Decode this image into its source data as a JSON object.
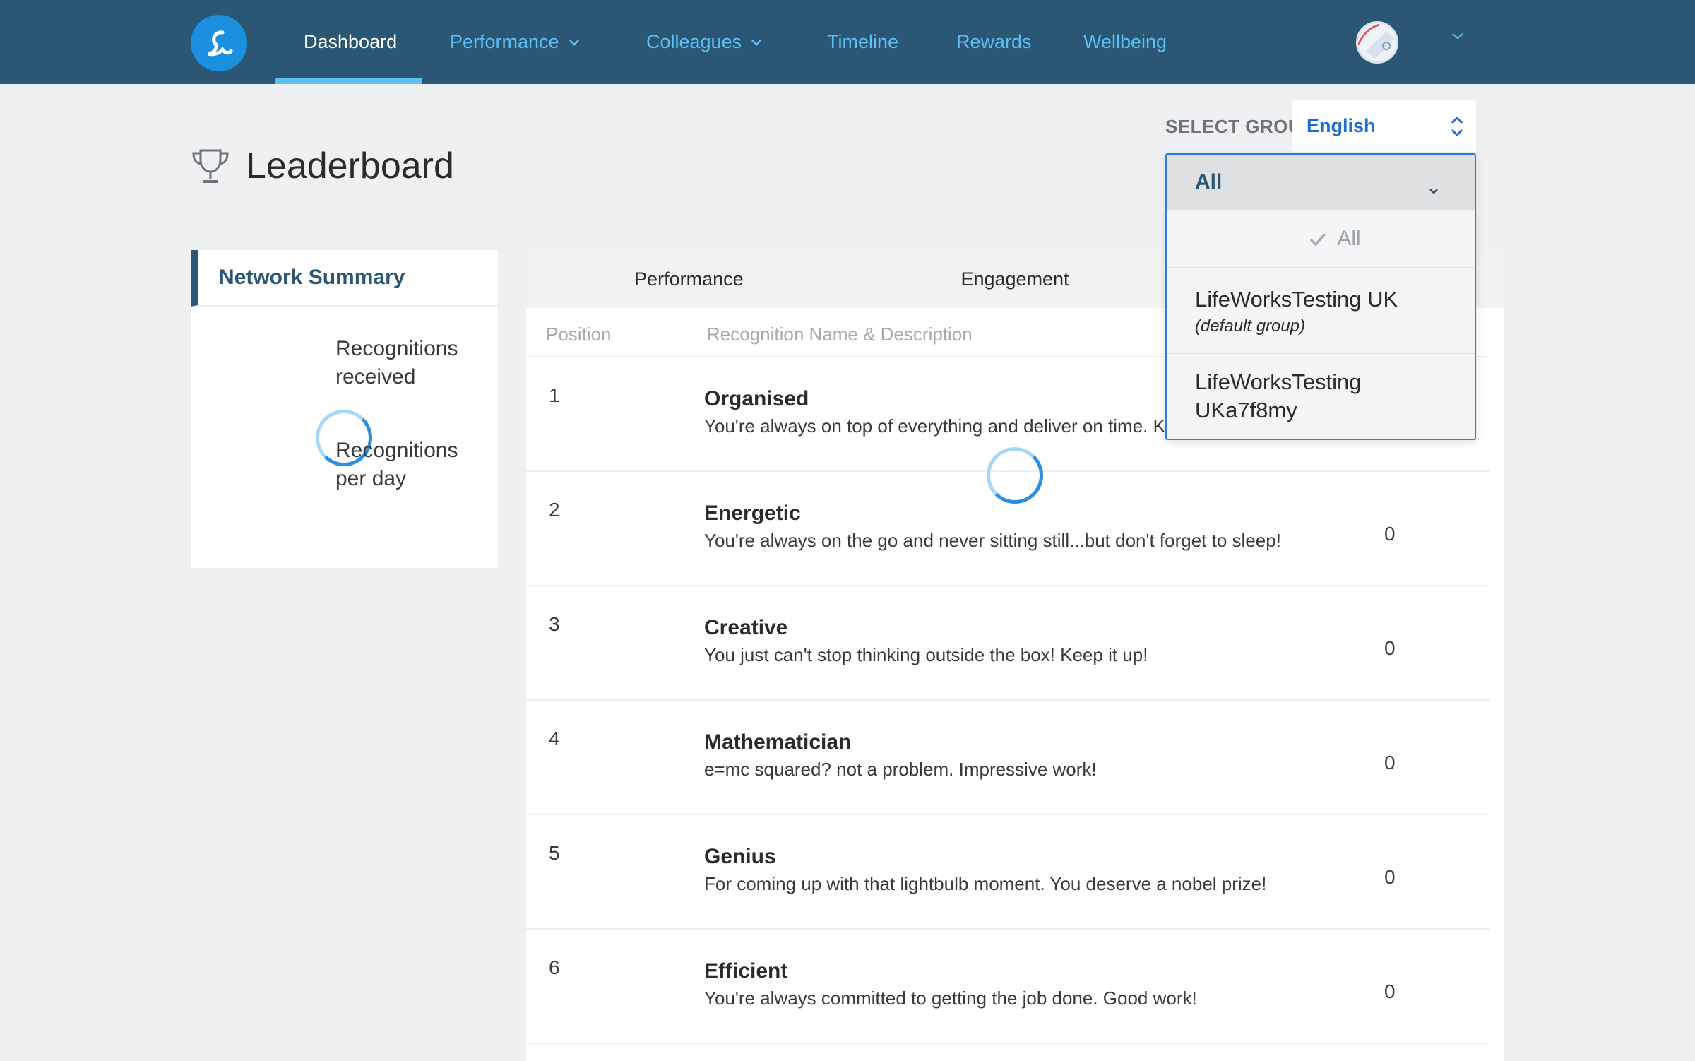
{
  "nav": {
    "logo_icon": "lifeworks-logo",
    "items": [
      {
        "label": "Dashboard",
        "active": true,
        "has_dropdown": false
      },
      {
        "label": "Performance",
        "active": false,
        "has_dropdown": true
      },
      {
        "label": "Colleagues",
        "active": false,
        "has_dropdown": true
      },
      {
        "label": "Timeline",
        "active": false,
        "has_dropdown": false
      },
      {
        "label": "Rewards",
        "active": false,
        "has_dropdown": false
      },
      {
        "label": "Wellbeing",
        "active": false,
        "has_dropdown": false
      }
    ],
    "user_menu_icon": "chevron-down-icon"
  },
  "page": {
    "title": "Leaderboard",
    "title_icon": "trophy-icon"
  },
  "group_select": {
    "label": "SELECT GROUP:",
    "language_value": "English",
    "dropdown": {
      "current": "All",
      "options": [
        {
          "name": "All",
          "sub": "",
          "selected": true
        },
        {
          "name": "LifeWorksTesting UK",
          "sub": "(default group)",
          "selected": false
        },
        {
          "name": "LifeWorksTesting UKa7f8my",
          "sub": "",
          "selected": false
        }
      ]
    }
  },
  "summary": {
    "title": "Network Summary",
    "stat1": "Recognitions received",
    "stat2": "Recognitions per day"
  },
  "table": {
    "tabs": [
      "Performance",
      "Engagement",
      ""
    ],
    "headers": {
      "position": "Position",
      "name": "Recognition Name & Description"
    },
    "rows": [
      {
        "position": "1",
        "name": "Organised",
        "description": "You're always on top of everything and deliver on time. Kee",
        "count": ""
      },
      {
        "position": "2",
        "name": "Energetic",
        "description": "You're always on the go and never sitting still...but don't forget to sleep!",
        "count": "0"
      },
      {
        "position": "3",
        "name": "Creative",
        "description": "You just can't stop thinking outside the box! Keep it up!",
        "count": "0"
      },
      {
        "position": "4",
        "name": "Mathematician",
        "description": "e=mc squared? not a problem. Impressive work!",
        "count": "0"
      },
      {
        "position": "5",
        "name": "Genius",
        "description": "For coming up with that lightbulb moment. You deserve a nobel prize!",
        "count": "0"
      },
      {
        "position": "6",
        "name": "Efficient",
        "description": "You're always committed to getting the job done. Good work!",
        "count": "0"
      }
    ]
  },
  "colors": {
    "nav_bg": "#2b5674",
    "nav_link": "#5cc0f5",
    "accent_blue": "#1a6fd1",
    "page_bg": "#eef0f2"
  }
}
